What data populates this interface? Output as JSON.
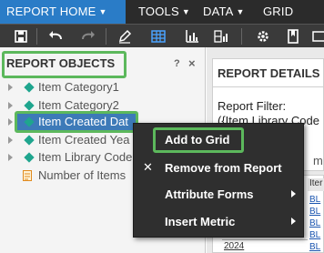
{
  "menubar": {
    "items": [
      {
        "label": "REPORT HOME"
      },
      {
        "label": "TOOLS"
      },
      {
        "label": "DATA"
      },
      {
        "label": "GRID"
      }
    ],
    "active_color": "#2a7cc7"
  },
  "toolbar": {
    "icons": [
      "save-icon",
      "undo-icon",
      "redo-icon",
      "edit-icon",
      "grid-view-icon",
      "graph-view-icon",
      "grid-graph-icon",
      "settings-icon",
      "bookmark-icon",
      "more-icon"
    ]
  },
  "left_panel": {
    "title": "REPORT OBJECTS",
    "help": "?",
    "close": "×",
    "items": [
      {
        "label": "Item Category1"
      },
      {
        "label": "Item Category2"
      },
      {
        "label": "Item Created Dat"
      },
      {
        "label": "Item Created Yea"
      },
      {
        "label": "Item Library Code"
      },
      {
        "label": "Number of Items"
      }
    ]
  },
  "right_panel": {
    "title": "REPORT DETAILS",
    "filter_label": "Report Filter:",
    "filter_expr": "({Item Library Code",
    "edge_fragment": "m",
    "grid_header": "Iter",
    "grid_links": [
      "BL",
      "BL",
      "BL",
      "BL",
      "BL"
    ],
    "grid_years": [
      "2024",
      "2024"
    ]
  },
  "context_menu": {
    "items": [
      {
        "label": "Add to Grid"
      },
      {
        "label": "Remove from Report"
      },
      {
        "label": "Attribute Forms"
      },
      {
        "label": "Insert Metric"
      }
    ],
    "remove_glyph": "✕"
  },
  "highlight_color": "#5cb85c"
}
